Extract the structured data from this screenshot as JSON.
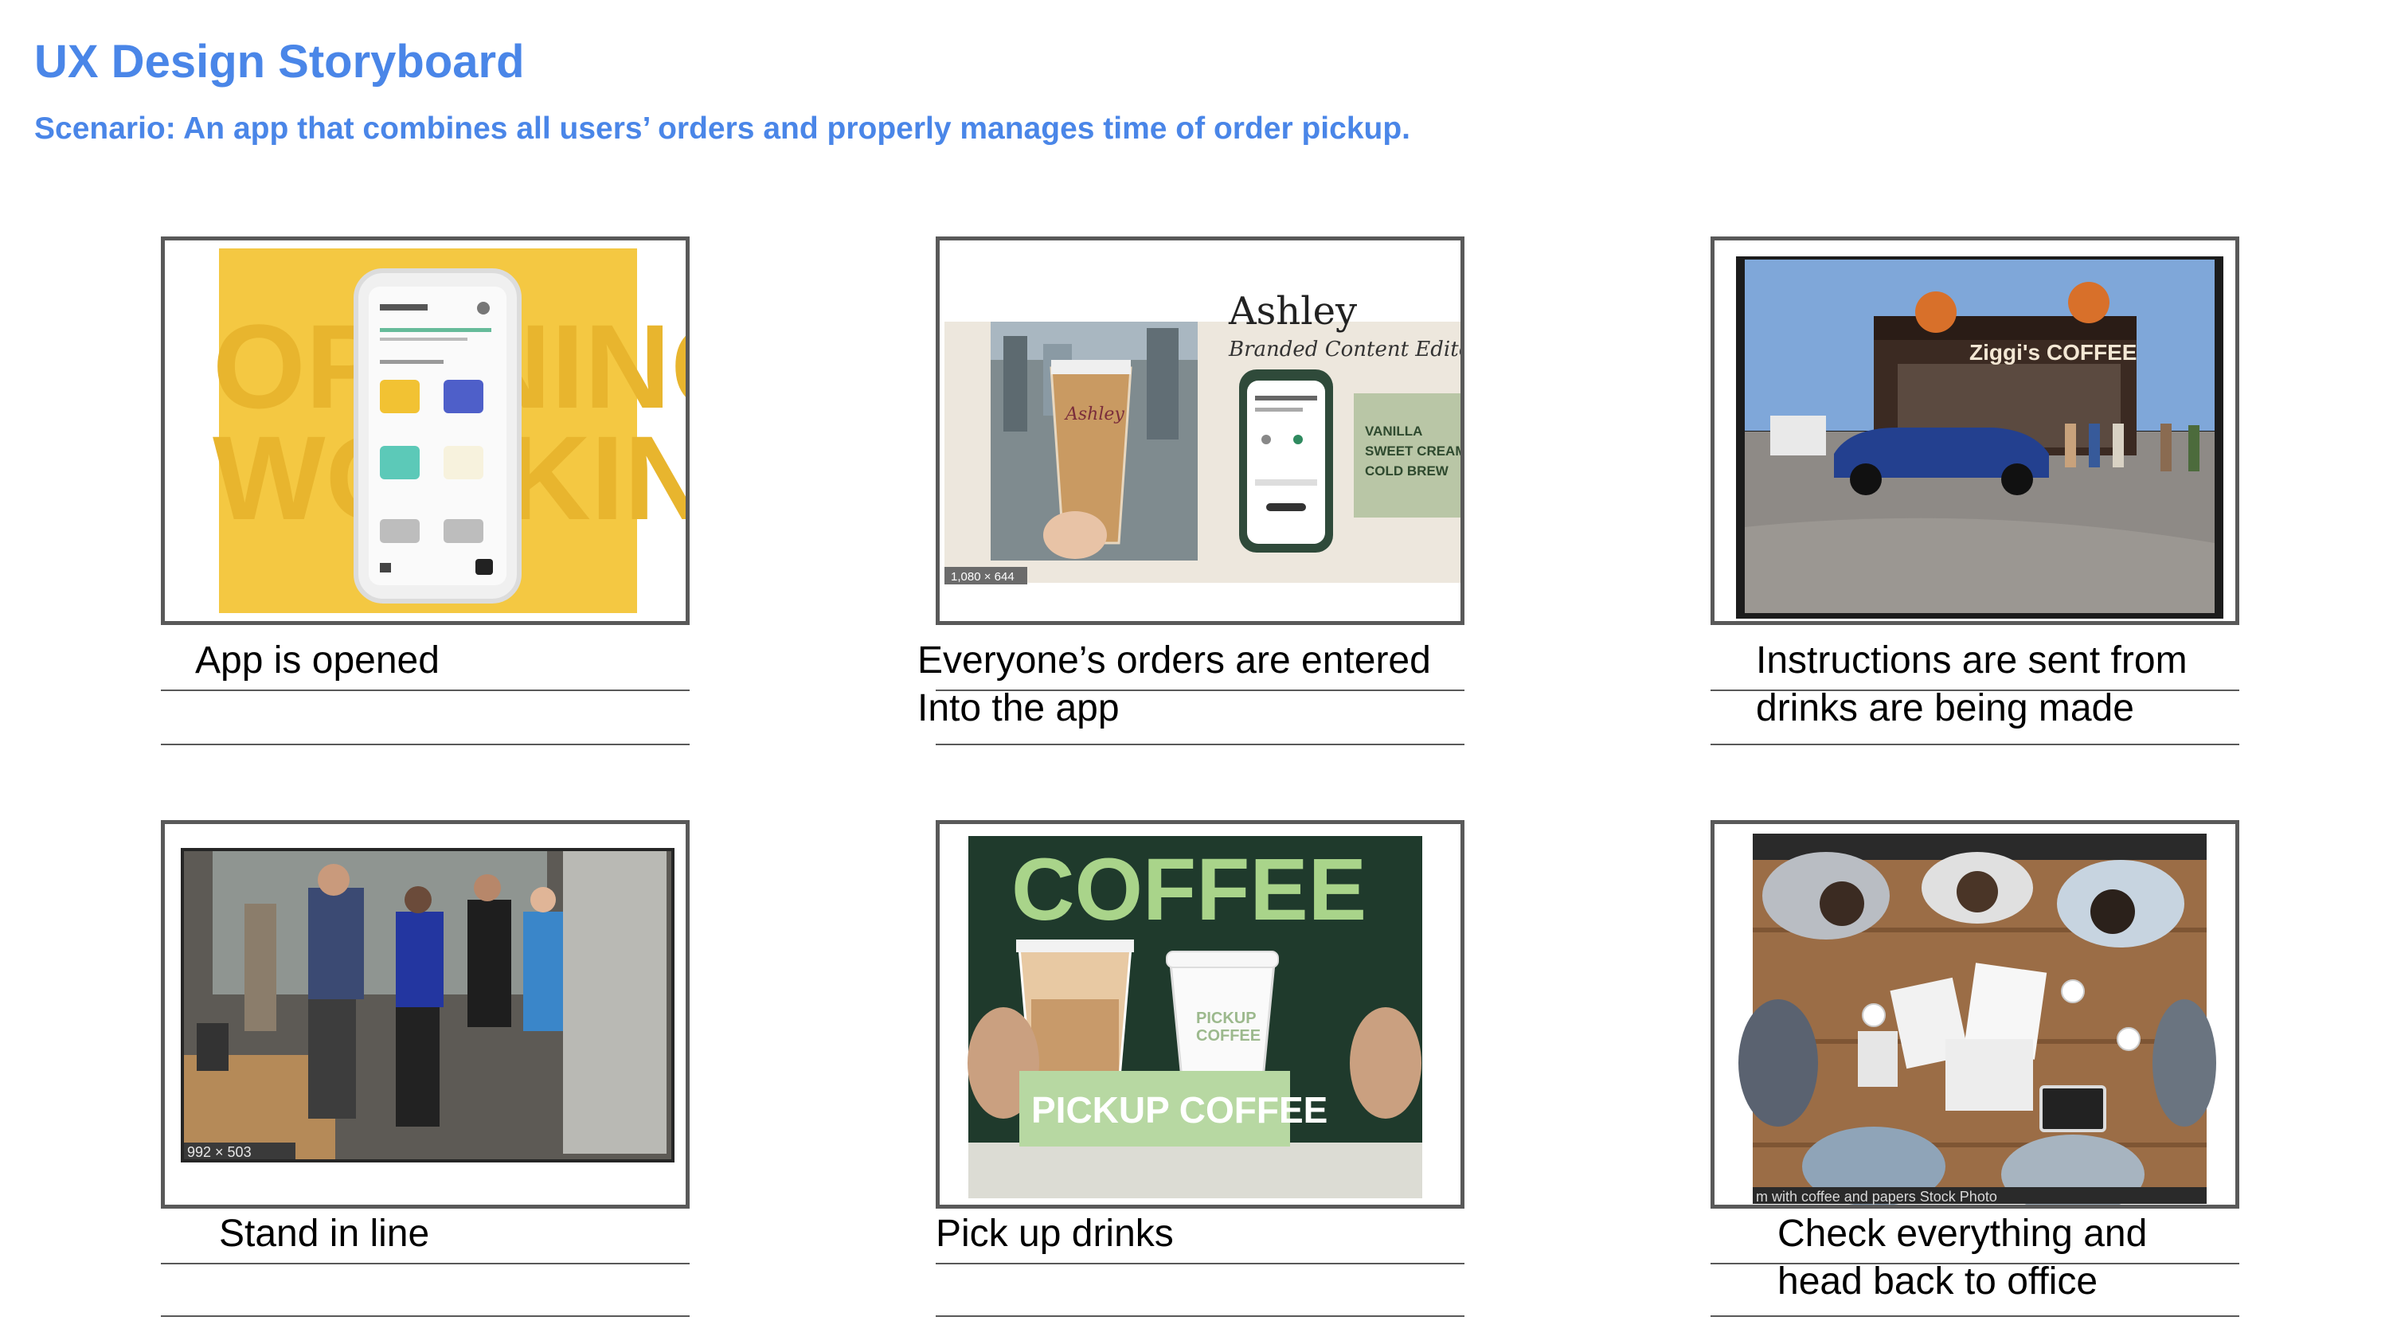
{
  "header": {
    "title": "UX Design Storyboard",
    "scenario": "Scenario: An app that combines all users’ orders and properly manages time of order pickup."
  },
  "panels": [
    {
      "caption_lines": [
        "App is opened"
      ],
      "image": "phone-app-mockup"
    },
    {
      "caption_lines": [
        "Everyone’s orders are entered",
        "Into the app"
      ],
      "image": "ordering-app-promo",
      "overlay_text": {
        "heading_partial": "Ashley",
        "subheading": "Branded Content Editor",
        "cup_label": "Ashley",
        "drink_lines": [
          "VANILLA",
          "SWEET CREAM",
          "COLD BREW"
        ],
        "size_badge": "1,080 × 644"
      }
    },
    {
      "caption_lines": [
        "Instructions are sent from",
        "drinks are being made"
      ],
      "image": "coffee-shop-storefront",
      "overlay_text": {
        "store_sign": "Ziggi's COFFEE"
      }
    },
    {
      "caption_lines": [
        "Stand in line"
      ],
      "image": "people-standing-in-line",
      "overlay_text": {
        "size_badge": "992 × 503"
      }
    },
    {
      "caption_lines": [
        "Pick up drinks"
      ],
      "image": "pickup-coffee-carrier",
      "overlay_text": {
        "apron_text": "COFFEE",
        "cup_text_top": "PICKUP",
        "cup_text_bottom": "COFFEE",
        "carrier_text": "PICKUP COFFEE"
      }
    },
    {
      "caption_lines": [
        "Check everything and",
        "head back to office"
      ],
      "image": "office-meeting-table",
      "overlay_text": {
        "stock_caption": "m with coffee and papers Stock Photo"
      }
    }
  ],
  "colors": {
    "heading_blue": "#4a86e8",
    "frame_border": "#595959"
  }
}
